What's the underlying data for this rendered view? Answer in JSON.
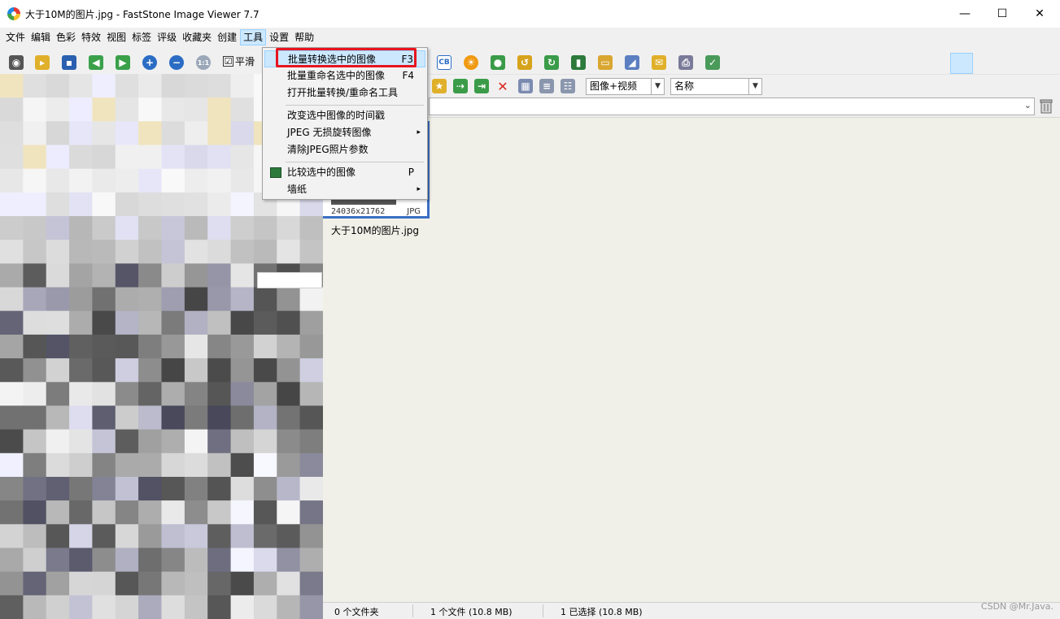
{
  "window": {
    "title": "大于10M的图片.jpg  -  FastStone Image Viewer 7.7",
    "minimize": "—",
    "maximize": "☐",
    "close": "✕"
  },
  "menu": [
    "文件",
    "编辑",
    "色彩",
    "特效",
    "视图",
    "标签",
    "评级",
    "收藏夹",
    "创建",
    "工具",
    "设置",
    "帮助"
  ],
  "menu_active_index": 9,
  "toolbar": {
    "smooth_label": "平滑",
    "smooth_checked": "☑",
    "view_mode": "图像+视频",
    "sort_by": "名称"
  },
  "dropdown": {
    "items": [
      {
        "label": "批量转换选中的图像",
        "key": "F3"
      },
      {
        "label": "批量重命名选中的图像",
        "key": "F4"
      },
      {
        "label": "打开批量转换/重命名工具",
        "key": ""
      },
      {
        "label": "改变选中图像的时间戳",
        "key": ""
      },
      {
        "label": "JPEG 无损旋转图像",
        "key": "▸"
      },
      {
        "label": "清除JPEG照片参数",
        "key": ""
      },
      {
        "label": "比较选中的图像",
        "key": "P"
      },
      {
        "label": "墙纸",
        "key": "▸"
      }
    ]
  },
  "thumbnail": {
    "dims": "24036x21762",
    "ext": "JPG",
    "name": "大于10M的图片.jpg"
  },
  "status": {
    "folders": "0 个文件夹",
    "files": "1 个文件 (10.8 MB)",
    "selected": "1 已选择 (10.8 MB)"
  },
  "watermark": "CSDN @Mr.Java."
}
